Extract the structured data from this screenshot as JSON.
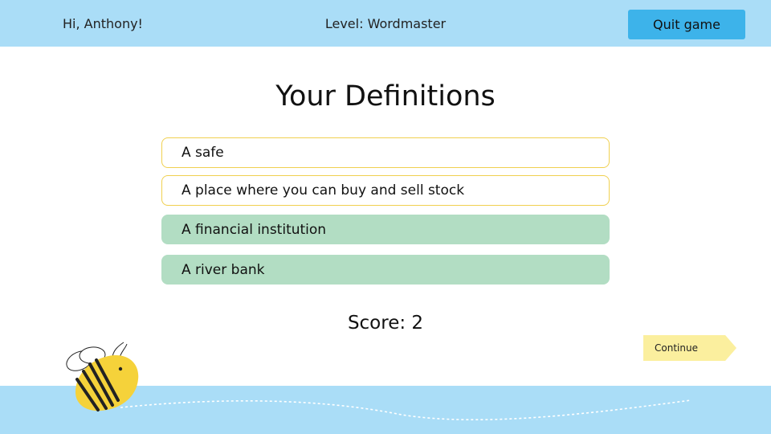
{
  "header": {
    "greeting": "Hi, Anthony!",
    "level": "Level: Wordmaster",
    "quit_label": "Quit game"
  },
  "main": {
    "title": "Your Definitions",
    "definitions": [
      {
        "text": "A safe",
        "state": "unselected"
      },
      {
        "text": "A place where you can buy and sell stock",
        "state": "unselected"
      },
      {
        "text": "A financial institution",
        "state": "correct"
      },
      {
        "text": "A river bank",
        "state": "correct"
      }
    ],
    "score": "Score: 2",
    "continue_label": "Continue"
  },
  "colors": {
    "header_bg": "#aaddf7",
    "quit_button": "#3db3ea",
    "option_border": "#f0d050",
    "correct_bg": "#b2ddc3",
    "continue_bg": "#fbef9e",
    "bee_yellow": "#f5d23a"
  },
  "icons": {
    "mascot": "bee-mascot-icon"
  }
}
